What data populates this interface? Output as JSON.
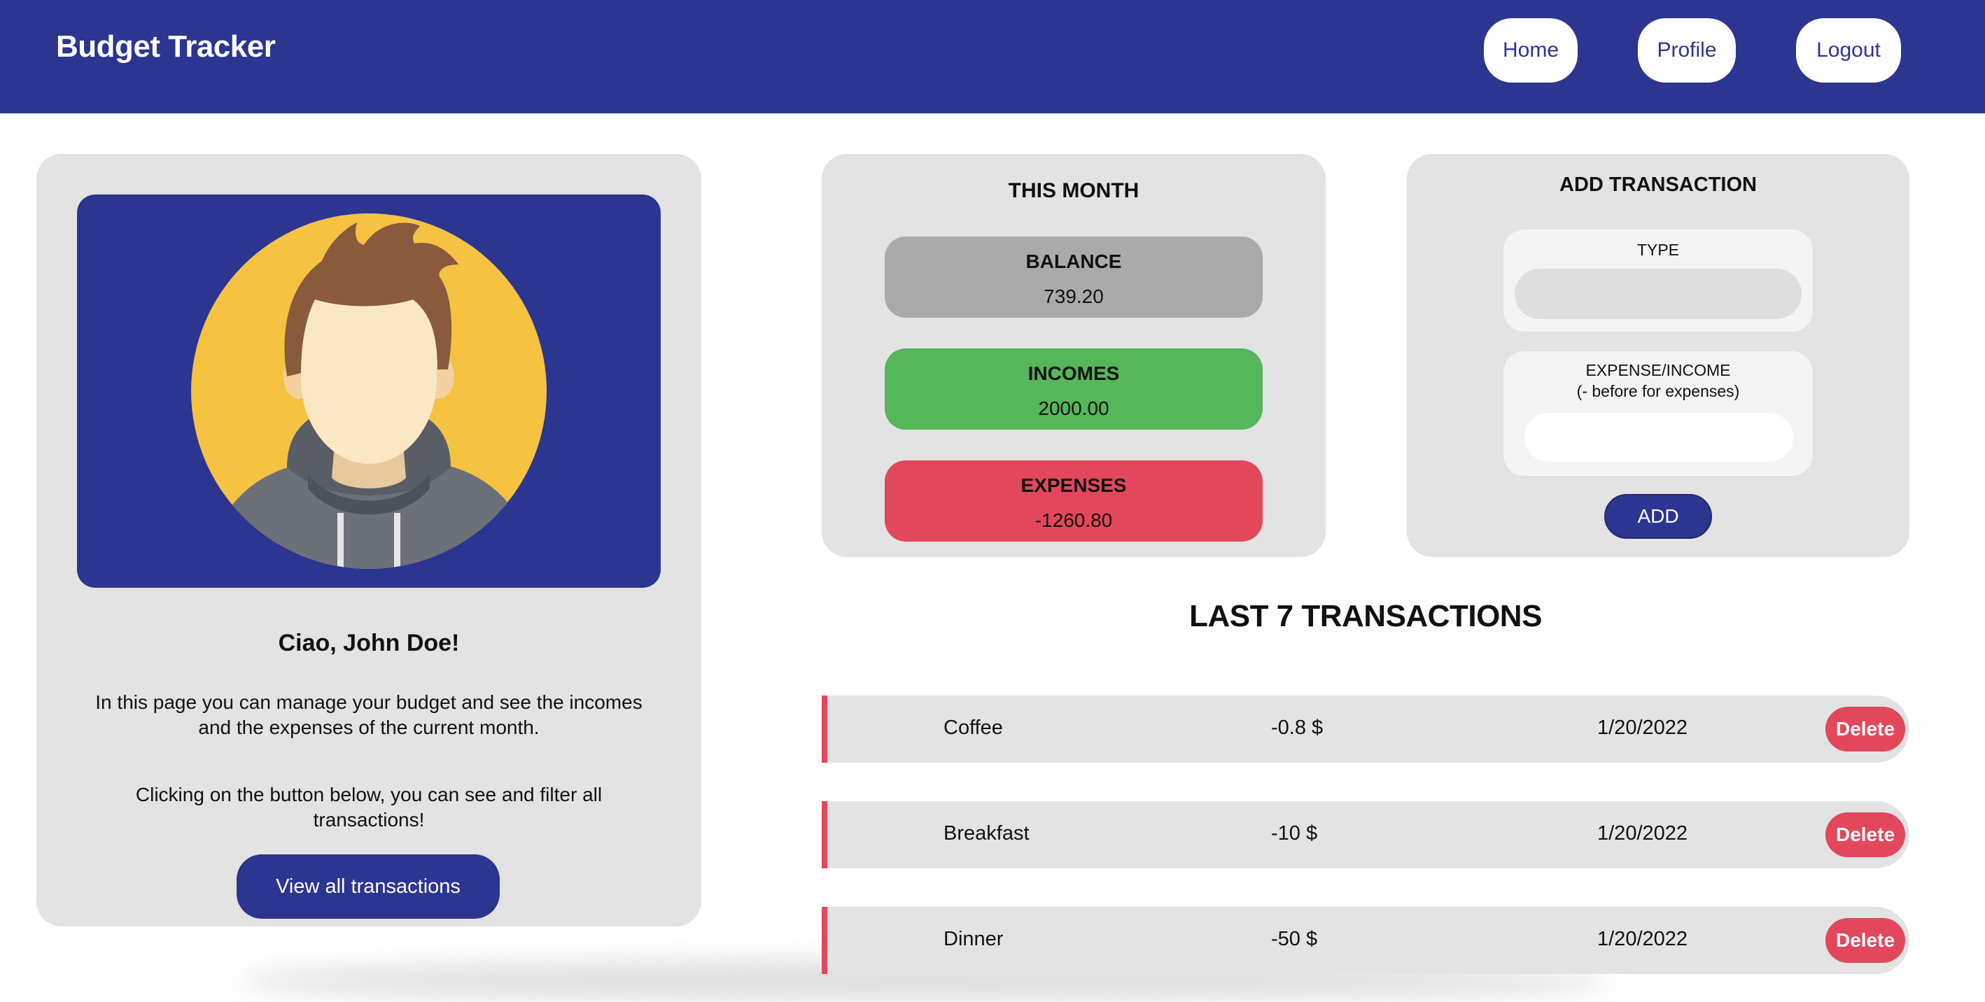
{
  "header": {
    "title": "Budget Tracker",
    "nav": [
      {
        "label": "Home"
      },
      {
        "label": "Profile"
      },
      {
        "label": "Logout"
      }
    ]
  },
  "profile": {
    "greeting": "Ciao, John Doe!",
    "description": "In this page you can manage your budget and see the incomes and the expenses of the current month.",
    "hint": "Clicking on the button below, you can see and filter all transactions!",
    "button_label": "View all transactions"
  },
  "month": {
    "title": "THIS MONTH",
    "balance": {
      "label": "BALANCE",
      "value": "739.20",
      "color": "#aaaaaa"
    },
    "incomes": {
      "label": "INCOMES",
      "value": "2000.00",
      "color": "#55b65a"
    },
    "expenses": {
      "label": "EXPENSES",
      "value": "-1260.80",
      "color": "#e3475b"
    }
  },
  "add_transaction": {
    "title": "ADD TRANSACTION",
    "type_label": "TYPE",
    "type_value": "",
    "amount_label": "EXPENSE/INCOME",
    "amount_hint": "(- before for expenses)",
    "amount_value": "",
    "button_label": "ADD"
  },
  "transactions": {
    "title": "LAST 7 TRANSACTIONS",
    "delete_label": "Delete",
    "rows": [
      {
        "name": "Coffee",
        "amount": "-0.8 $",
        "date": "1/20/2022"
      },
      {
        "name": "Breakfast",
        "amount": "-10 $",
        "date": "1/20/2022"
      },
      {
        "name": "Dinner",
        "amount": "-50 $",
        "date": "1/20/2022"
      }
    ]
  },
  "colors": {
    "primary": "#2c3590",
    "expense": "#e3475b",
    "income": "#55b65a",
    "card": "#e3e3e3"
  }
}
